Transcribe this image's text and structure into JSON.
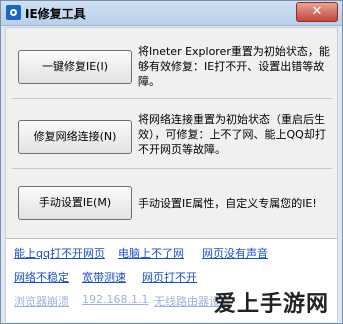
{
  "window": {
    "title": "IE修复工具",
    "close_label": "✕"
  },
  "actions": [
    {
      "button_label": "一键修复IE(I)",
      "description": "将Ineter Explorer重置为初始状态，能够有效修复：IE打不开、设置出错等故障。"
    },
    {
      "button_label": "修复网络连接(N)",
      "description": "将网络连接重置为初始状态（重启后生效），可修复：上不了网、能上QQ却打不开网页等故障。"
    },
    {
      "button_label": "手动设置IE(M)",
      "description": "手动设置IE属性，自定义专属您的IE!"
    }
  ],
  "links": {
    "row1": [
      "能上qq打不开网页",
      "电脑上不了网",
      "网页没有声音"
    ],
    "row2": [
      "网络不稳定",
      "宽带测速",
      "网页打不开"
    ],
    "row3": [
      "浏览器崩溃",
      "192.168.1.1",
      "无线路由器设置"
    ]
  },
  "watermark": "爱上手游网"
}
